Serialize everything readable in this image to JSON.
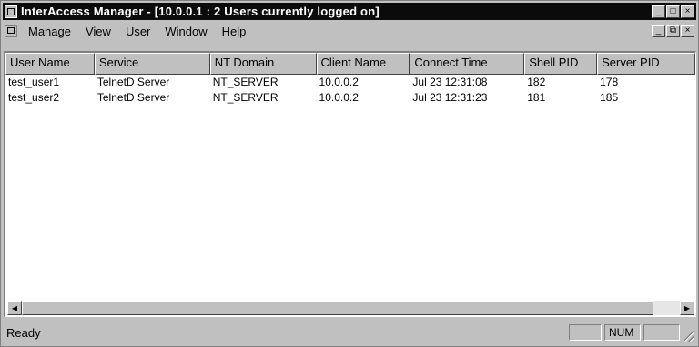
{
  "window": {
    "title": "InterAccess Manager - [10.0.0.1 : 2 Users currently logged on]",
    "controls": [
      "_",
      "□",
      "×"
    ]
  },
  "menubar": {
    "items": [
      "Manage",
      "View",
      "User",
      "Window",
      "Help"
    ],
    "child_controls": [
      "_",
      "⧉",
      "×"
    ]
  },
  "table": {
    "columns": [
      "User Name",
      "Service",
      "NT Domain",
      "Client Name",
      "Connect Time",
      "Shell PID",
      "Server PID"
    ],
    "rows": [
      [
        "test_user1",
        "TelnetD Server",
        "NT_SERVER",
        "10.0.0.2",
        "Jul 23 12:31:08",
        "182",
        "178"
      ],
      [
        "test_user2",
        "TelnetD Server",
        "NT_SERVER",
        "10.0.0.2",
        "Jul 23 12:31:23",
        "181",
        "185"
      ]
    ]
  },
  "scrollbar": {
    "left_arrow": "◀",
    "right_arrow": "▶"
  },
  "statusbar": {
    "text": "Ready",
    "num_indicator": "NUM"
  }
}
